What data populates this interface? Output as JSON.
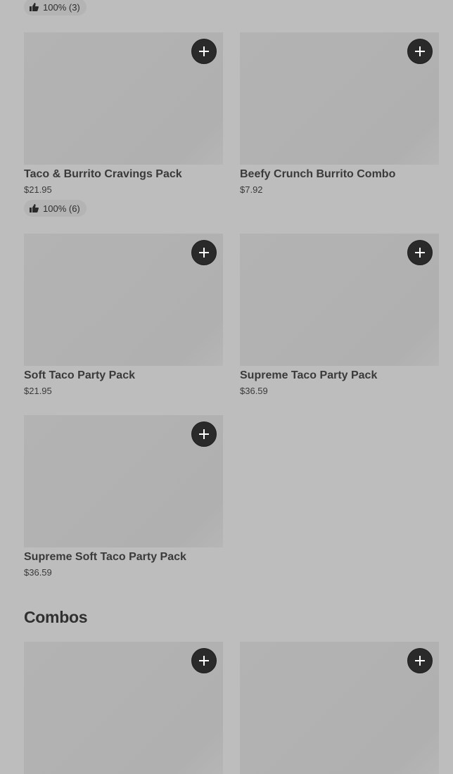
{
  "top_rating": {
    "text": "100% (3)"
  },
  "products": [
    {
      "name": "Taco & Burrito Cravings Pack",
      "price": "$21.95",
      "rating": "100% (6)"
    },
    {
      "name": "Beefy Crunch Burrito Combo",
      "price": "$7.92"
    },
    {
      "name": "Soft Taco Party Pack",
      "price": "$21.95"
    },
    {
      "name": "Supreme Taco Party Pack",
      "price": "$36.59"
    },
    {
      "name": "Supreme Soft Taco Party Pack",
      "price": "$36.59"
    }
  ],
  "combos": {
    "title": "Combos"
  },
  "icons": {
    "add": "plus-icon",
    "rating": "thumbs-up-icon"
  }
}
